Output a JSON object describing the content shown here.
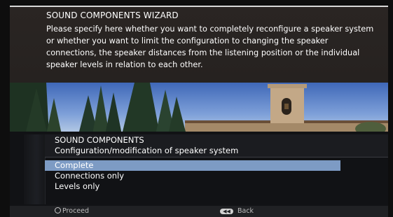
{
  "wizard": {
    "title": "SOUND COMPONENTS WIZARD",
    "description": "Please specify here whether you want to completely reconfigure a speaker system or whether you want to limit the configuration to changing the speaker connections, the speaker distances from the listening position or the individual speaker levels in relation to each other."
  },
  "panel": {
    "title": "SOUND COMPONENTS",
    "subtitle": "Configuration/modification of speaker system",
    "options": [
      "Complete",
      "Connections only",
      "Levels only"
    ],
    "selected_index": 0
  },
  "footer": {
    "proceed_label": "Proceed",
    "back_label": "Back",
    "back_icon_glyph": "◀◀"
  },
  "icons": {
    "proceed": "ok-button-icon",
    "back": "back-button-icon"
  },
  "colors": {
    "selection_highlight": "#7d9bc4",
    "text": "#ffffff",
    "footer_text": "#bdbdbd"
  }
}
